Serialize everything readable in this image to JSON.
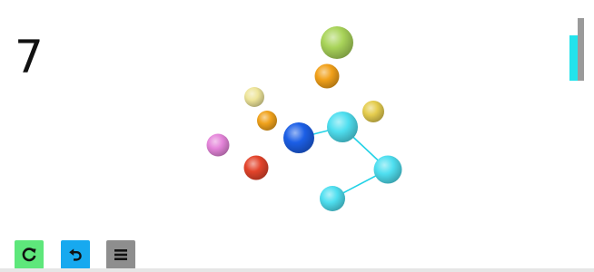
{
  "game": {
    "moves_remaining": "7"
  },
  "progress": {
    "level": 0.72,
    "fill_color": "#22e3ec",
    "track_color": "#9a9a9a"
  },
  "controls": {
    "restart": {
      "icon": "restart-icon",
      "color": "#5ee77b"
    },
    "undo": {
      "icon": "undo-icon",
      "color": "#17a9ef"
    },
    "menu": {
      "icon": "menu-icon",
      "color": "#8e8e8e"
    }
  },
  "molecule": {
    "atoms": [
      {
        "id": "a1",
        "color": "#a9d45a",
        "label": "lime-sphere"
      },
      {
        "id": "a2",
        "color": "#f2a11a",
        "label": "orange-sphere-top"
      },
      {
        "id": "a3",
        "color": "#eee59a",
        "label": "pale-yellow-sphere"
      },
      {
        "id": "a4",
        "color": "#f0a21c",
        "label": "orange-sphere-small"
      },
      {
        "id": "a5",
        "color": "#e5cd4f",
        "label": "gold-sphere"
      },
      {
        "id": "a6",
        "color": "#e585da",
        "label": "pink-sphere"
      },
      {
        "id": "a7",
        "color": "#1c5fe6",
        "label": "blue-sphere"
      },
      {
        "id": "a8",
        "color": "#4fdff0",
        "label": "cyan-sphere-1"
      },
      {
        "id": "a9",
        "color": "#e3442b",
        "label": "red-sphere"
      },
      {
        "id": "a10",
        "color": "#4fdff0",
        "label": "cyan-sphere-2"
      },
      {
        "id": "a11",
        "color": "#4fdff0",
        "label": "cyan-sphere-3"
      }
    ],
    "bonds": [
      {
        "from": "a7",
        "to": "a8",
        "color": "#22d2e6"
      },
      {
        "from": "a8",
        "to": "a10",
        "color": "#22d2e6"
      },
      {
        "from": "a10",
        "to": "a11",
        "color": "#22d2e6"
      }
    ]
  }
}
